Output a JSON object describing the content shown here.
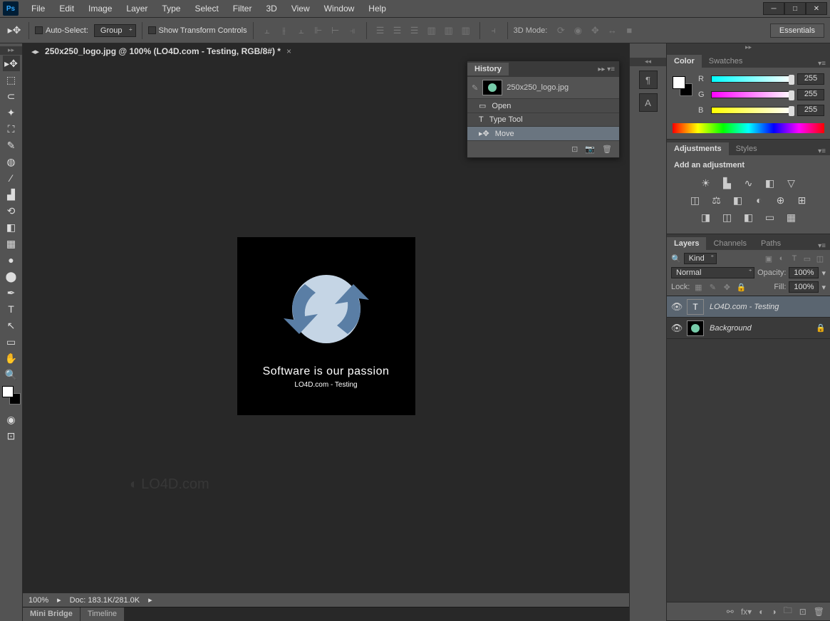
{
  "app": {
    "logo": "Ps"
  },
  "menu": [
    "File",
    "Edit",
    "Image",
    "Layer",
    "Type",
    "Select",
    "Filter",
    "3D",
    "View",
    "Window",
    "Help"
  ],
  "options": {
    "auto_select": "Auto-Select:",
    "group": "Group",
    "transform": "Show Transform Controls",
    "mode3d": "3D Mode:",
    "workspace": "Essentials"
  },
  "doc_tab": "250x250_logo.jpg @ 100% (LO4D.com - Testing, RGB/8#) *",
  "canvas": {
    "tagline": "Software is our passion",
    "subtitle": "LO4D.com - Testing"
  },
  "watermark": "LO4D.com",
  "status": {
    "zoom": "100%",
    "doc": "Doc: 183.1K/281.0K"
  },
  "bottom_tabs": [
    "Mini Bridge",
    "Timeline"
  ],
  "history": {
    "title": "History",
    "doc": "250x250_logo.jpg",
    "items": [
      {
        "icon": "▭",
        "label": "Open"
      },
      {
        "icon": "T",
        "label": "Type Tool"
      },
      {
        "icon": "↕",
        "label": "Move"
      }
    ]
  },
  "color_panel": {
    "tabs": [
      "Color",
      "Swatches"
    ],
    "r": {
      "label": "R",
      "value": "255"
    },
    "g": {
      "label": "G",
      "value": "255"
    },
    "b": {
      "label": "B",
      "value": "255"
    }
  },
  "adjustments": {
    "tabs": [
      "Adjustments",
      "Styles"
    ],
    "title": "Add an adjustment"
  },
  "layers": {
    "tabs": [
      "Layers",
      "Channels",
      "Paths"
    ],
    "kind": "Kind",
    "blend": "Normal",
    "opacity_label": "Opacity:",
    "opacity": "100%",
    "lock_label": "Lock:",
    "fill_label": "Fill:",
    "fill": "100%",
    "items": [
      {
        "name": "LO4D.com - Testing",
        "type": "T",
        "locked": false,
        "active": true
      },
      {
        "name": "Background",
        "type": "img",
        "locked": true,
        "active": false,
        "italic": true
      }
    ]
  }
}
